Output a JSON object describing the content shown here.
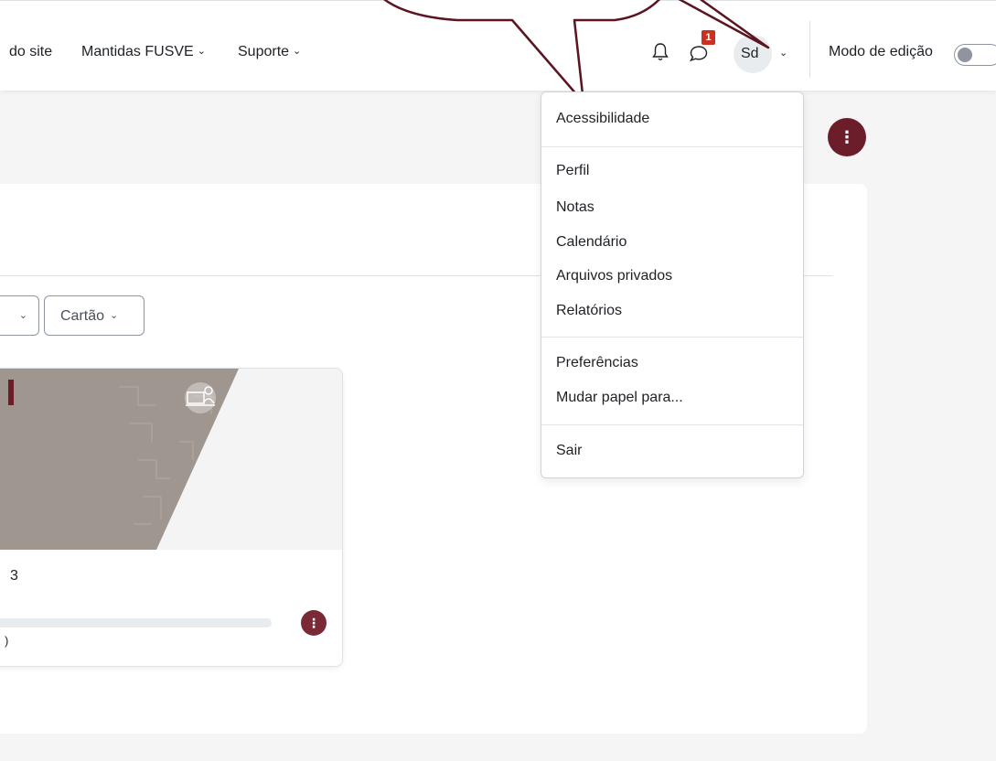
{
  "nav": {
    "site_partial": "do site",
    "mantidas": "Mantidas FUSVE",
    "suporte": "Suporte",
    "chevron": "⌄",
    "messages_badge": "1",
    "avatar_initials": "Sd",
    "edit_mode_label": "Modo de edição",
    "edit_mode_on": false
  },
  "page_action_glyph": "⋮",
  "filters": {
    "first_chevron": "⌄",
    "view_label": "Cartão"
  },
  "course": {
    "name_partial": "3",
    "progress_partial": ")",
    "action_glyph": "⋮"
  },
  "user_menu": {
    "items": [
      {
        "label": "Acessibilidade"
      },
      {
        "label": "Perfil"
      },
      {
        "label": "Notas"
      },
      {
        "label": "Calendário"
      },
      {
        "label": "Arquivos privados"
      },
      {
        "label": "Relatórios"
      },
      {
        "label": "Preferências"
      },
      {
        "label": "Mudar papel para..."
      },
      {
        "label": "Sair"
      }
    ]
  },
  "colors": {
    "brand": "#6b1d2a",
    "badge": "#ca3120",
    "course_image": "#a09690"
  }
}
